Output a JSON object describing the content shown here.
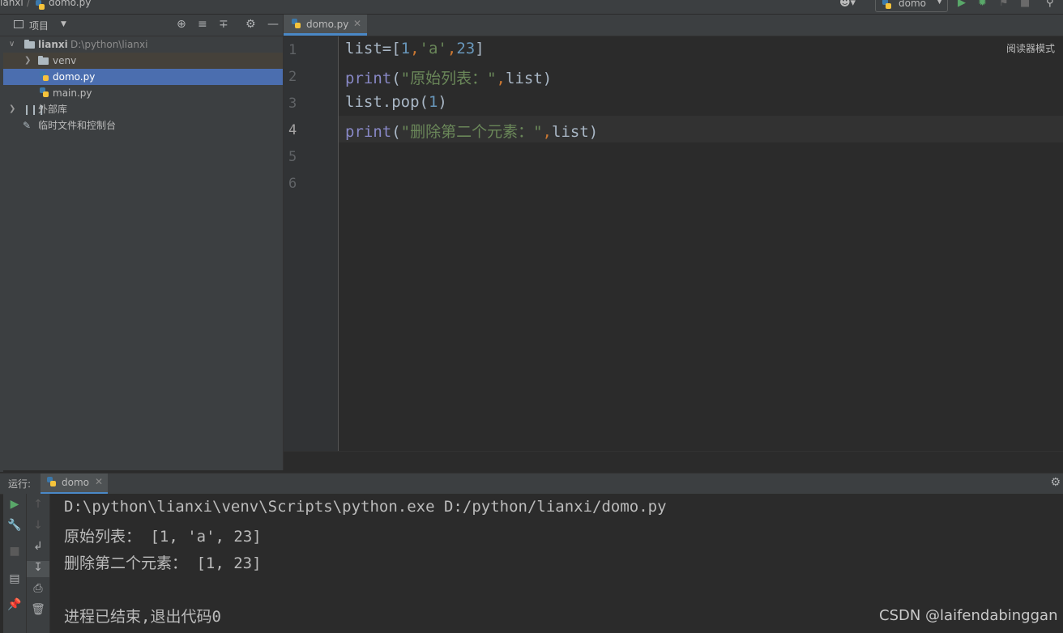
{
  "navbar": {
    "project": "ianxi",
    "separator": "/",
    "file": "domo.py",
    "run_config": "domo"
  },
  "project_panel": {
    "title": "项目",
    "tree": [
      {
        "label": "lianxi",
        "path": "D:\\python\\lianxi"
      },
      {
        "label": "venv"
      },
      {
        "label": "domo.py"
      },
      {
        "label": "main.py"
      },
      {
        "label": "外部库"
      },
      {
        "label": "临时文件和控制台"
      }
    ]
  },
  "editor": {
    "tab_label": "domo.py",
    "reader_mode": "阅读器模式",
    "line_numbers": [
      "1",
      "2",
      "3",
      "4",
      "5",
      "6"
    ],
    "code": {
      "l1": {
        "a": "list=[",
        "b": "1",
        "c": ",",
        "d": "'a'",
        "e": ",",
        "f": "23",
        "g": "]"
      },
      "l2": {
        "a": "print",
        "b": "(",
        "c": "\"原始列表：\"",
        "d": ",",
        "e": "list)"
      },
      "l3": {
        "a": "list.pop(",
        "b": "1",
        "c": ")"
      },
      "l4": {
        "a": "print",
        "b": "(",
        "c": "\"删除第二个元素：\"",
        "d": ",",
        "e": "list)"
      }
    }
  },
  "run_panel": {
    "label": "运行:",
    "tab_label": "domo",
    "console": [
      "D:\\python\\lianxi\\venv\\Scripts\\python.exe D:/python/lianxi/domo.py",
      "原始列表： [1, 'a', 23]",
      "删除第二个元素： [1, 23]",
      "",
      "进程已结束,退出代码0"
    ]
  },
  "watermark": "CSDN @laifendabinggan",
  "colors": {
    "background": "#2b2b2b",
    "panel": "#3c3f41",
    "selection": "#4b6eaf",
    "keyword": "#8888c6",
    "number": "#6897bb",
    "string": "#6a8759",
    "operator": "#cc7832",
    "run_green": "#59a869"
  }
}
